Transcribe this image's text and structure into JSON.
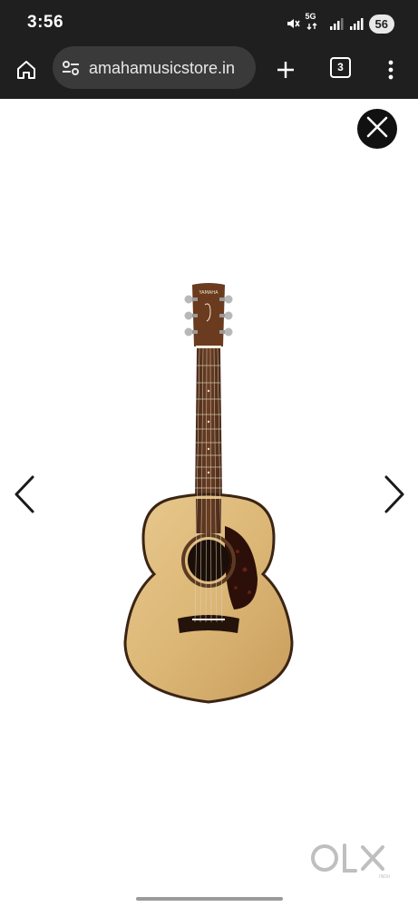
{
  "status_bar": {
    "time": "3:56",
    "network_label": "5G",
    "battery_level": "56"
  },
  "browser": {
    "url_display": "amahamusicstore.in",
    "tab_count": "3"
  },
  "viewer": {
    "image_subject": "acoustic-guitar",
    "brand_on_headstock": "YAMAHA",
    "watermark": "OLX"
  },
  "colors": {
    "status_bar_bg": "#1f1f1f",
    "url_box_bg": "#3a3a3a",
    "page_bg": "#ffffff",
    "close_button_bg": "#111111"
  }
}
